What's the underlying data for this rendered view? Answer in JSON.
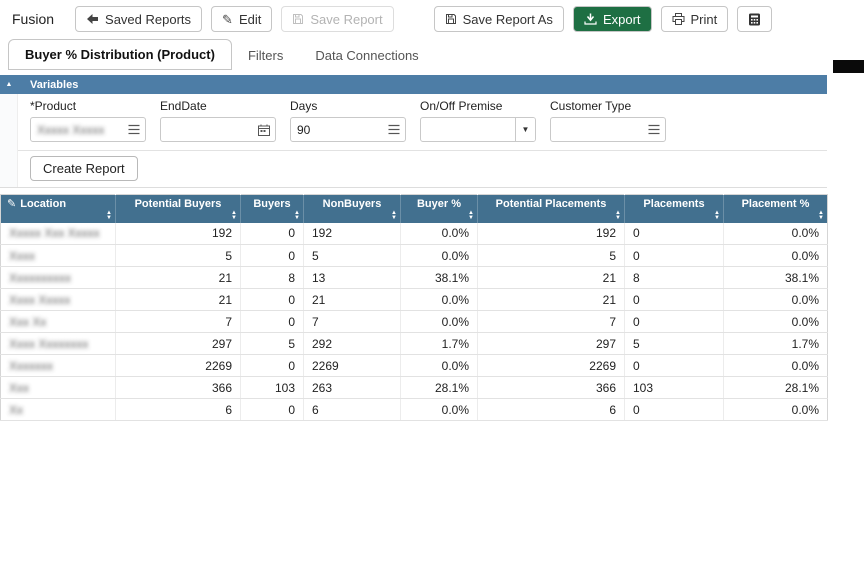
{
  "app_name": "Fusion",
  "toolbar": {
    "buttons": [
      {
        "label": "Saved Reports",
        "icon": "back-arrow"
      },
      {
        "label": "Edit",
        "icon": "pencil"
      },
      {
        "label": "Save Report",
        "icon": "save",
        "disabled": true
      },
      {
        "label": "Save Report As",
        "icon": "save"
      },
      {
        "label": "Export",
        "icon": "download",
        "primary": true
      },
      {
        "label": "Print",
        "icon": "printer"
      },
      {
        "label": "",
        "icon": "calculator"
      }
    ]
  },
  "tabs": [
    {
      "label": "Buyer % Distribution (Product)",
      "active": true
    },
    {
      "label": "Filters",
      "active": false
    },
    {
      "label": "Data Connections",
      "active": false
    }
  ],
  "variables": {
    "title": "Variables",
    "create_report_label": "Create Report",
    "fields": [
      {
        "label": "*Product",
        "value": "Xxxxx Xxxxx",
        "redacted": true,
        "icon": "list"
      },
      {
        "label": "EndDate",
        "value": "",
        "redacted": false,
        "icon": "calendar"
      },
      {
        "label": "Days",
        "value": "90",
        "redacted": false,
        "icon": "list"
      },
      {
        "label": "On/Off Premise",
        "value": "",
        "redacted": false,
        "icon": "dropdown-caret"
      },
      {
        "label": "Customer Type",
        "value": "",
        "redacted": false,
        "icon": "list"
      }
    ]
  },
  "table": {
    "columns": [
      {
        "label": "Location",
        "align": "left"
      },
      {
        "label": "Potential Buyers",
        "align": "right"
      },
      {
        "label": "Buyers",
        "align": "right"
      },
      {
        "label": "NonBuyers",
        "align": "left"
      },
      {
        "label": "Buyer %",
        "align": "right"
      },
      {
        "label": "Potential Placements",
        "align": "right"
      },
      {
        "label": "Placements",
        "align": "left"
      },
      {
        "label": "Placement %",
        "align": "right"
      }
    ],
    "rows": [
      {
        "location": "Xxxxx Xxx Xxxxx",
        "location_redacted": true,
        "values": [
          "192",
          "0",
          "192",
          "0.0%",
          "192",
          "0",
          "0.0%"
        ]
      },
      {
        "location": "Xxxx",
        "location_redacted": true,
        "values": [
          "5",
          "0",
          "5",
          "0.0%",
          "5",
          "0",
          "0.0%"
        ]
      },
      {
        "location": "Xxxxxxxxxx",
        "location_redacted": true,
        "values": [
          "21",
          "8",
          "13",
          "38.1%",
          "21",
          "8",
          "38.1%"
        ]
      },
      {
        "location": "Xxxx Xxxxx",
        "location_redacted": true,
        "values": [
          "21",
          "0",
          "21",
          "0.0%",
          "21",
          "0",
          "0.0%"
        ]
      },
      {
        "location": "Xxx Xx",
        "location_redacted": true,
        "values": [
          "7",
          "0",
          "7",
          "0.0%",
          "7",
          "0",
          "0.0%"
        ]
      },
      {
        "location": "Xxxx Xxxxxxxx",
        "location_redacted": true,
        "values": [
          "297",
          "5",
          "292",
          "1.7%",
          "297",
          "5",
          "1.7%"
        ]
      },
      {
        "location": "Xxxxxxx",
        "location_redacted": true,
        "values": [
          "2269",
          "0",
          "2269",
          "0.0%",
          "2269",
          "0",
          "0.0%"
        ]
      },
      {
        "location": "Xxx",
        "location_redacted": true,
        "values": [
          "366",
          "103",
          "263",
          "28.1%",
          "366",
          "103",
          "28.1%"
        ]
      },
      {
        "location": "Xx",
        "location_redacted": true,
        "values": [
          "6",
          "0",
          "6",
          "0.0%",
          "6",
          "0",
          "0.0%"
        ]
      }
    ]
  },
  "colors": {
    "panel_header_blue": "#4d7da6",
    "table_header_blue": "#42708f",
    "export_green": "#1e6f43"
  }
}
